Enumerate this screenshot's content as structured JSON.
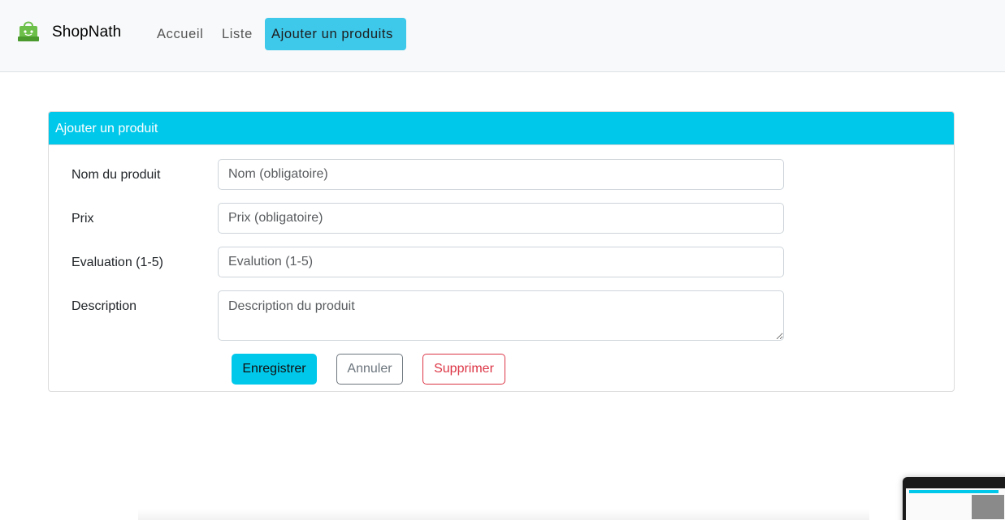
{
  "navbar": {
    "brand": "ShopNath",
    "links": [
      {
        "label": "Accueil"
      },
      {
        "label": "Liste"
      },
      {
        "label": "Ajouter un produits",
        "active": true
      }
    ]
  },
  "card": {
    "title": "Ajouter un produit",
    "fields": [
      {
        "label": "Nom du produit",
        "placeholder": "Nom (obligatoire)",
        "value": ""
      },
      {
        "label": "Prix",
        "placeholder": "Prix (obligatoire)",
        "value": ""
      },
      {
        "label": "Evaluation (1-5)",
        "placeholder": "Evalution (1-5)",
        "value": ""
      },
      {
        "label": "Description",
        "placeholder": "Description du produit",
        "value": ""
      }
    ],
    "buttons": {
      "save": "Enregistrer",
      "cancel": "Annuler",
      "delete": "Supprimer"
    }
  },
  "colors": {
    "accent": "#00c8ea",
    "nav_active": "#3ec8ea",
    "danger": "#dc3545",
    "secondary": "#6c757d",
    "navbar_bg": "#f8f9fa"
  },
  "icons": {
    "brand": "shopping-bag-icon"
  }
}
